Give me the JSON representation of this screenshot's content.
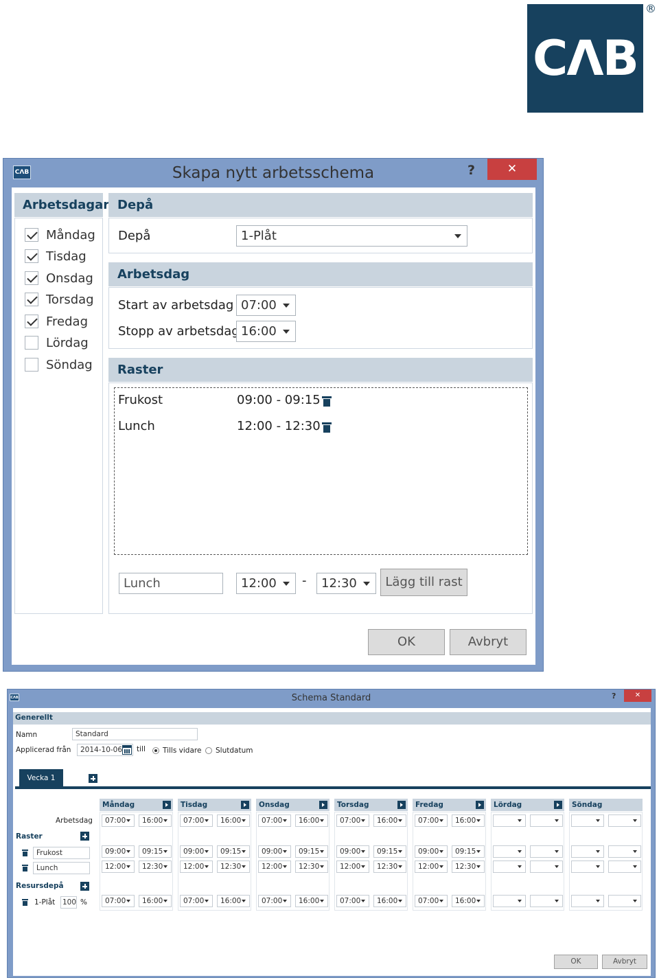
{
  "logo": {
    "text": "CΛB",
    "registered": "®"
  },
  "dialog1": {
    "title": "Skapa nytt arbetsschema",
    "help": "?",
    "close": "✕",
    "app_icon": "CΛB",
    "workdays": {
      "header": "Arbetsdagar",
      "days": [
        {
          "label": "Måndag",
          "checked": true
        },
        {
          "label": "Tisdag",
          "checked": true
        },
        {
          "label": "Onsdag",
          "checked": true
        },
        {
          "label": "Torsdag",
          "checked": true
        },
        {
          "label": "Fredag",
          "checked": true
        },
        {
          "label": "Lördag",
          "checked": false
        },
        {
          "label": "Söndag",
          "checked": false
        }
      ]
    },
    "depot": {
      "header": "Depå",
      "label": "Depå",
      "value": "1-Plåt"
    },
    "workday": {
      "header": "Arbetsdag",
      "start_label": "Start av arbetsdag",
      "start_value": "07:00",
      "stop_label": "Stopp av arbetsdag",
      "stop_value": "16:00"
    },
    "breaks": {
      "header": "Raster",
      "items": [
        {
          "name": "Frukost",
          "time": "09:00 - 09:15"
        },
        {
          "name": "Lunch",
          "time": "12:00 - 12:30"
        }
      ],
      "new_name": "Lunch",
      "new_from": "12:00",
      "dash": "-",
      "new_to": "12:30",
      "add_button": "Lägg till rast"
    },
    "ok": "OK",
    "cancel": "Avbryt"
  },
  "dialog2": {
    "title": "Schema Standard",
    "help": "?",
    "close": "✕",
    "app_icon": "CΛB",
    "general": {
      "header": "Generellt",
      "name_label": "Namn",
      "name_value": "Standard",
      "applied_label": "Applicerad från",
      "date_value": "2014-10-06",
      "till": "till",
      "until_further": "Tills vidare",
      "end_date": "Slutdatum"
    },
    "tab": "Vecka 1",
    "row_labels": {
      "workday": "Arbetsdag",
      "breaks": "Raster",
      "break1": "Frukost",
      "break2": "Lunch",
      "depots": "Resursdepå",
      "depot1": "1-Plåt",
      "percent_value": "100",
      "percent_sign": "%"
    },
    "days": [
      {
        "name": "Måndag",
        "work": [
          "07:00",
          "16:00"
        ],
        "b1": [
          "09:00",
          "09:15"
        ],
        "b2": [
          "12:00",
          "12:30"
        ],
        "dep": [
          "07:00",
          "16:00"
        ]
      },
      {
        "name": "Tisdag",
        "work": [
          "07:00",
          "16:00"
        ],
        "b1": [
          "09:00",
          "09:15"
        ],
        "b2": [
          "12:00",
          "12:30"
        ],
        "dep": [
          "07:00",
          "16:00"
        ]
      },
      {
        "name": "Onsdag",
        "work": [
          "07:00",
          "16:00"
        ],
        "b1": [
          "09:00",
          "09:15"
        ],
        "b2": [
          "12:00",
          "12:30"
        ],
        "dep": [
          "07:00",
          "16:00"
        ]
      },
      {
        "name": "Torsdag",
        "work": [
          "07:00",
          "16:00"
        ],
        "b1": [
          "09:00",
          "09:15"
        ],
        "b2": [
          "12:00",
          "12:30"
        ],
        "dep": [
          "07:00",
          "16:00"
        ]
      },
      {
        "name": "Fredag",
        "work": [
          "07:00",
          "16:00"
        ],
        "b1": [
          "09:00",
          "09:15"
        ],
        "b2": [
          "12:00",
          "12:30"
        ],
        "dep": [
          "07:00",
          "16:00"
        ]
      },
      {
        "name": "Lördag",
        "work": [
          "",
          ""
        ],
        "b1": [
          "",
          ""
        ],
        "b2": [
          "",
          ""
        ],
        "dep": [
          "",
          ""
        ]
      },
      {
        "name": "Söndag",
        "work": [
          "",
          ""
        ],
        "b1": [
          "",
          ""
        ],
        "b2": [
          "",
          ""
        ],
        "dep": [
          "",
          ""
        ]
      }
    ],
    "ok": "OK",
    "cancel": "Avbryt"
  },
  "colors": {
    "brand": "#17415e",
    "window_frame": "#7f9cc8",
    "section_header": "#c9d4de",
    "close_red": "#c84040"
  },
  "icons": [
    "cab-logo",
    "app-icon",
    "help-icon",
    "close-icon",
    "checkbox-icon",
    "chevron-down-icon",
    "trash-icon",
    "plus-icon",
    "calendar-icon",
    "radio-icon",
    "arrow-right-icon"
  ]
}
